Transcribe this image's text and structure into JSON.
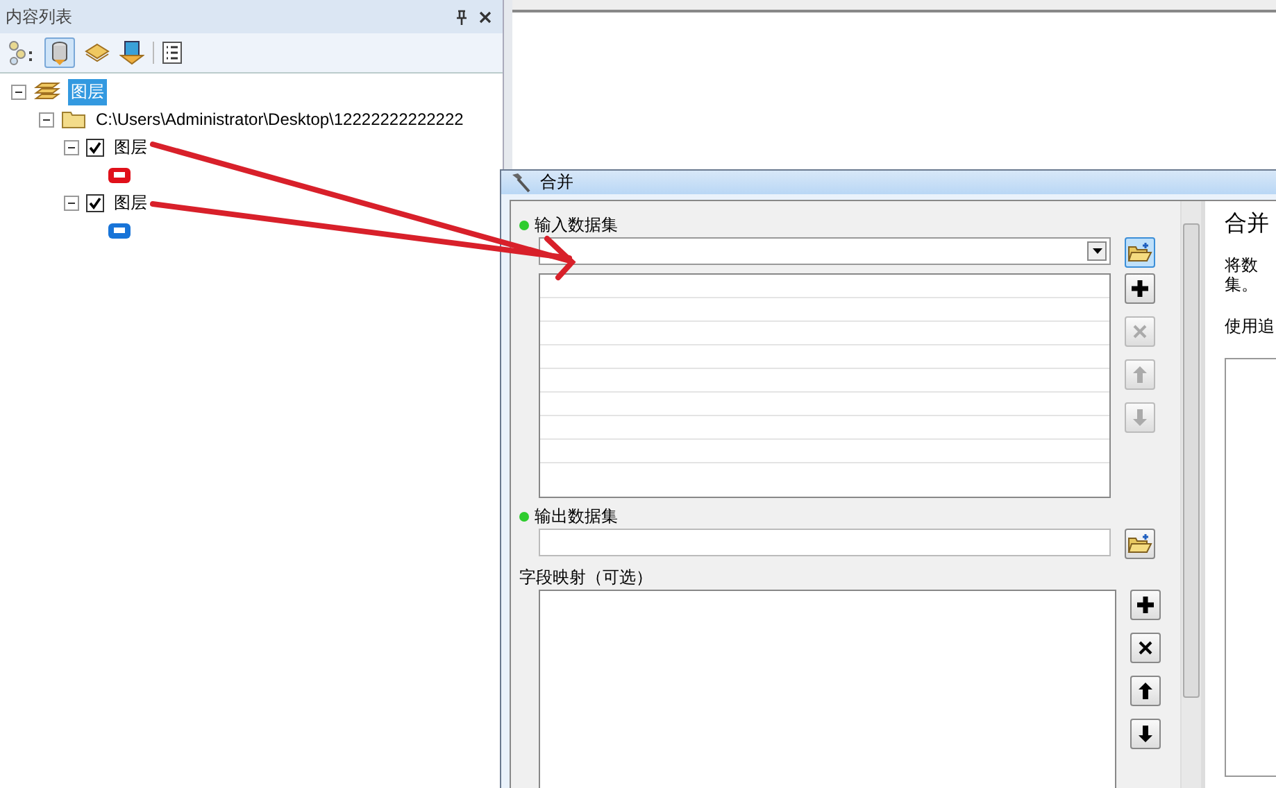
{
  "panel": {
    "title": "内容列表"
  },
  "tree": [
    {
      "label": "图层",
      "selected": true,
      "expanded": true,
      "children": [
        {
          "label": "C:\\Users\\Administrator\\Desktop\\12222222222222",
          "expanded": true,
          "children": [
            {
              "label": "图层",
              "checked": true,
              "expanded": true,
              "color": "#e0101a"
            },
            {
              "label": "图层",
              "checked": true,
              "expanded": true,
              "color": "#1874d8"
            }
          ]
        }
      ]
    }
  ],
  "dialog": {
    "title": "合并",
    "input": {
      "label": "输入数据集",
      "required": true,
      "buttons": [
        {
          "kind": "add",
          "disabled": false
        },
        {
          "kind": "remove",
          "disabled": true
        },
        {
          "kind": "up",
          "disabled": true
        },
        {
          "kind": "down",
          "disabled": true
        }
      ]
    },
    "output": {
      "label": "输出数据集",
      "required": true
    },
    "field_map": {
      "label": "字段映射（可选）",
      "buttons": [
        {
          "kind": "add",
          "disabled": false
        },
        {
          "kind": "remove",
          "disabled": false
        },
        {
          "kind": "up",
          "disabled": false
        },
        {
          "kind": "down",
          "disabled": false
        }
      ]
    },
    "help": {
      "title": "合并",
      "lines": [
        "将数",
        "集。",
        "使用追"
      ]
    }
  }
}
